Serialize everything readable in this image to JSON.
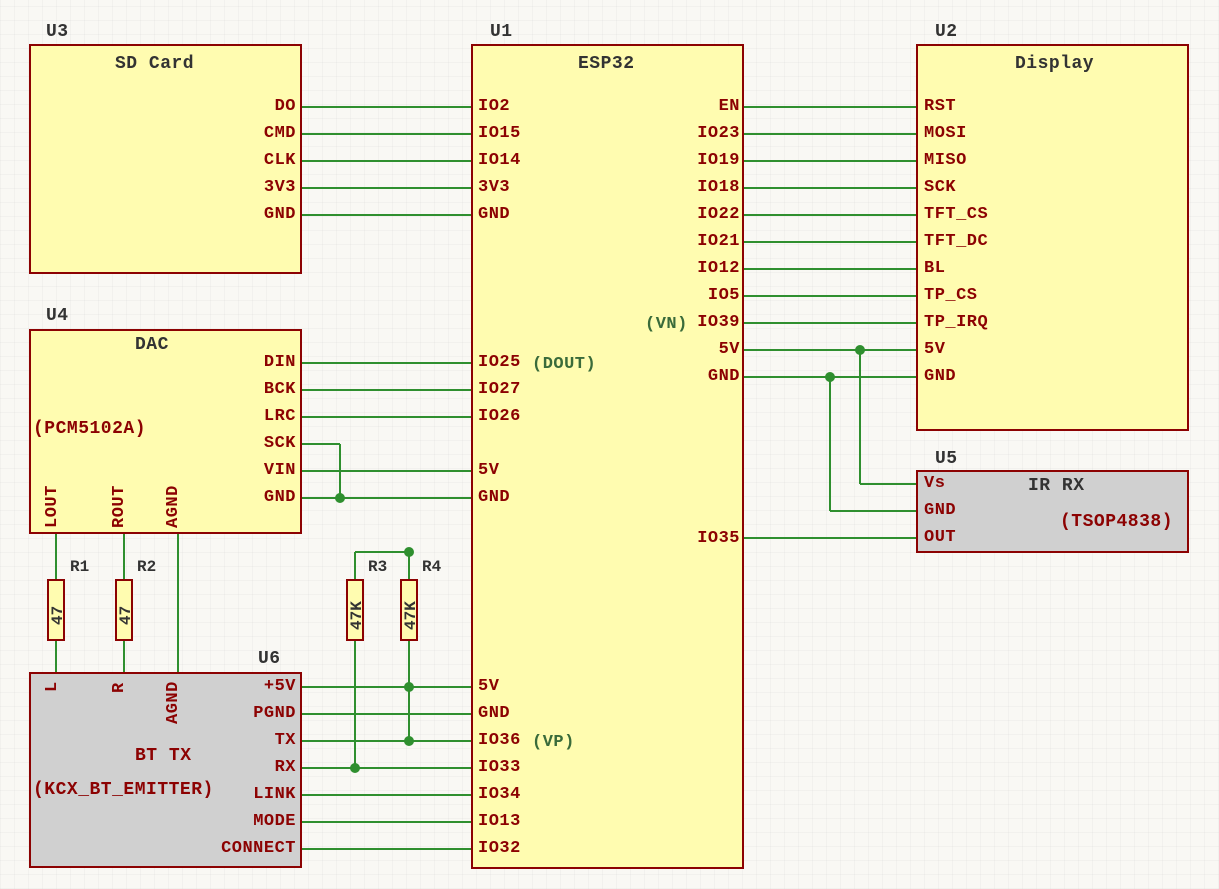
{
  "components": {
    "U1": {
      "ref": "U1",
      "name": "ESP32",
      "pins_left_top": [
        "IO2",
        "IO15",
        "IO14",
        "3V3",
        "GND"
      ],
      "pins_left_mid": [
        "IO25",
        "IO27",
        "IO26",
        "",
        "5V",
        "GND"
      ],
      "pin_left_dout_note": "(DOUT)",
      "pins_left_bot": [
        "5V",
        "GND",
        "IO36",
        "IO33",
        "IO34",
        "IO13",
        "IO32"
      ],
      "pin_left_vp_note": "(VP)",
      "pins_right": [
        "EN",
        "IO23",
        "IO19",
        "IO18",
        "IO22",
        "IO21",
        "IO12",
        "IO5",
        "IO39",
        "5V",
        "GND"
      ],
      "pin_right_vn_note": "(VN)",
      "pin_right_io35": "IO35"
    },
    "U2": {
      "ref": "U2",
      "name": "Display",
      "pins_left": [
        "RST",
        "MOSI",
        "MISO",
        "SCK",
        "TFT_CS",
        "TFT_DC",
        "BL",
        "TP_CS",
        "TP_IRQ",
        "5V",
        "GND"
      ]
    },
    "U3": {
      "ref": "U3",
      "name": "SD Card",
      "pins_right": [
        "DO",
        "CMD",
        "CLK",
        "3V3",
        "GND"
      ]
    },
    "U4": {
      "ref": "U4",
      "name": "DAC",
      "sub": "(PCM5102A)",
      "pins_right": [
        "DIN",
        "BCK",
        "LRC",
        "SCK",
        "VIN",
        "GND"
      ],
      "pins_bottom": [
        "LOUT",
        "ROUT",
        "AGND"
      ]
    },
    "U5": {
      "ref": "U5",
      "name": "IR RX",
      "sub": "(TSOP4838)",
      "pins_left": [
        "Vs",
        "GND",
        "OUT"
      ]
    },
    "U6": {
      "ref": "U6",
      "name": "BT TX",
      "sub": "(KCX_BT_EMITTER)",
      "pins_right": [
        "+5V",
        "PGND",
        "TX",
        "RX",
        "LINK",
        "MODE",
        "CONNECT"
      ],
      "pins_top": [
        "L",
        "R",
        "AGND"
      ]
    }
  },
  "resistors": {
    "R1": {
      "ref": "R1",
      "value": "47"
    },
    "R2": {
      "ref": "R2",
      "value": "47"
    },
    "R3": {
      "ref": "R3",
      "value": "47K"
    },
    "R4": {
      "ref": "R4",
      "value": "47K"
    }
  }
}
